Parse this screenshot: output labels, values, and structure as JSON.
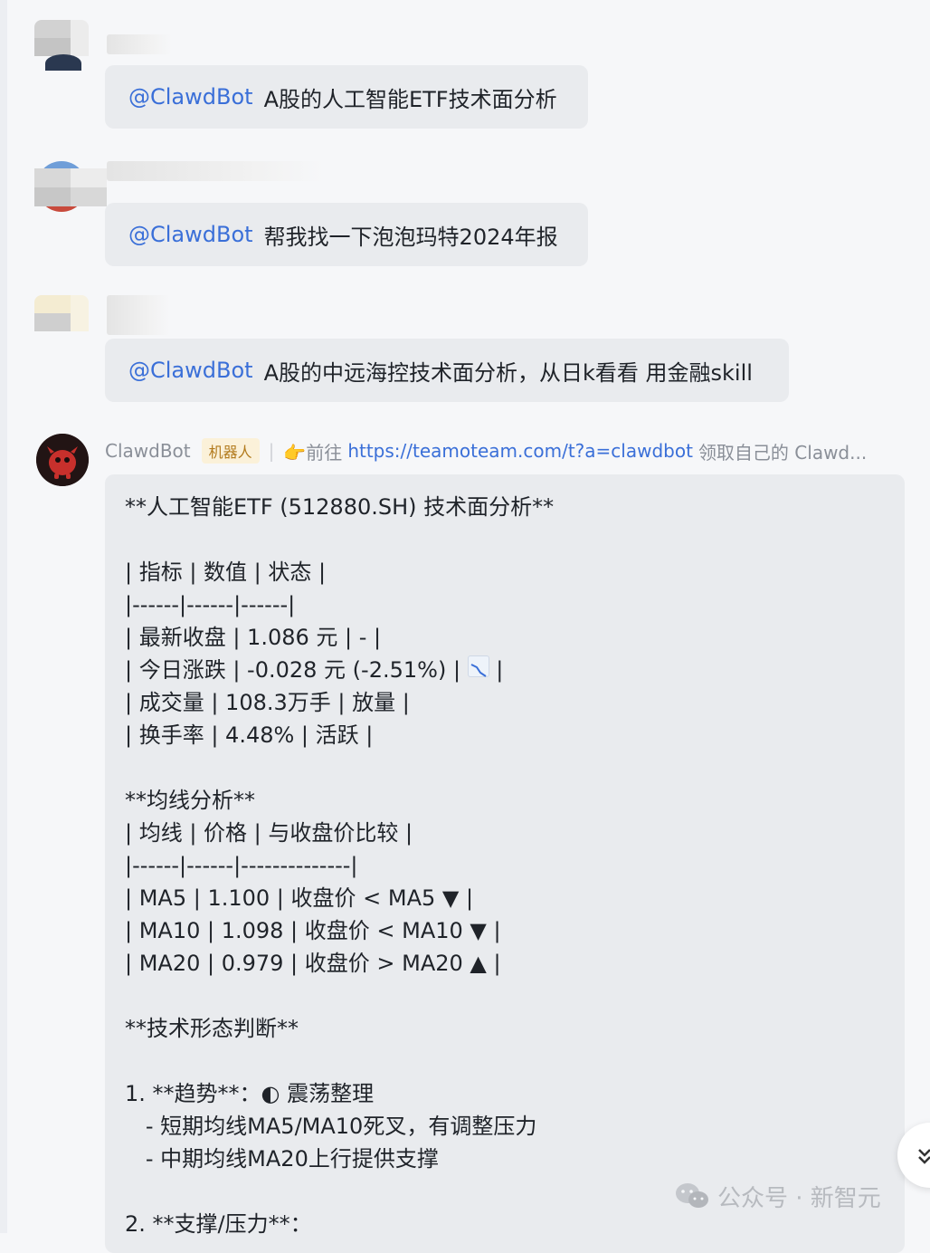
{
  "messages": [
    {
      "mention": "@ClawdBot",
      "text": "A股的人工智能ETF技术面分析"
    },
    {
      "mention": "@ClawdBot",
      "text": "帮我找一下泡泡玛特2024年报"
    },
    {
      "mention": "@ClawdBot",
      "text": "A股的中远海控技术面分析，从日k看看 用金融skill"
    }
  ],
  "bot": {
    "name": "ClawdBot",
    "badge": "机器人",
    "prefix": "👉前往",
    "link": "https://teamoteam.com/t?a=clawdbot",
    "suffix": "领取自己的 Clawd..."
  },
  "response_lines": [
    "**人工智能ETF (512880.SH) 技术面分析**",
    "",
    "| 指标 | 数值 | 状态 |",
    "|------|------|------|",
    "| 最新收盘 | 1.086 元 | - |",
    "| 今日涨跌 | -0.028 元 (-2.51%) | ",
    "| 成交量 | 108.3万手 | 放量 |",
    "| 换手率 | 4.48% | 活跃 |",
    "",
    "**均线分析**",
    "| 均线 | 价格 | 与收盘价比较 |",
    "|------|------|--------------|",
    "| MA5 | 1.100 | 收盘价 < MA5 ▼ |",
    "| MA10 | 1.098 | 收盘价 < MA10 ▼ |",
    "| MA20 | 0.979 | 收盘价 > MA20 ▲ |",
    "",
    "**技术形态判断**",
    "",
    "1. **趋势**：◐ 震荡整理",
    "   - 短期均线MA5/MA10死叉，有调整压力",
    "   - 中期均线MA20上行提供支撑",
    "",
    "2. **支撑/压力**："
  ],
  "change_row_tail": " |",
  "icons": {
    "chart_down": "chart-decreasing-icon"
  },
  "watermark": {
    "text": "公众号 · 新智元"
  },
  "colors": {
    "mention": "#3a6fd8",
    "bubble": "#e9ebee",
    "badge_bg": "#fbf1d9",
    "badge_text": "#b27a1c"
  }
}
